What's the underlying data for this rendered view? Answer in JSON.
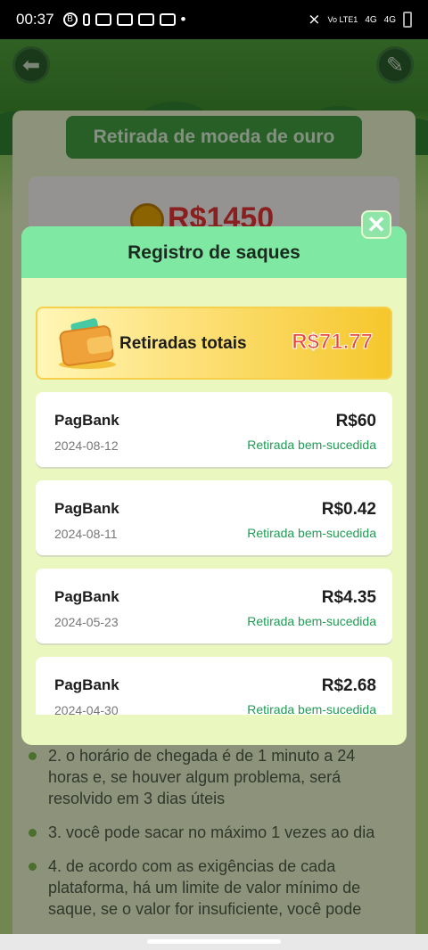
{
  "status_bar": {
    "time": "00:37",
    "b_badge": "B",
    "net_label": "Vo LTE1",
    "sig1": "4G",
    "sig2": "4G"
  },
  "background": {
    "title": "Retirada de moeda de ouro",
    "balance": "R$1450",
    "rules": [
      "2. o horário de chegada é de 1 minuto a 24 horas e, se houver algum problema, será resolvido em 3 dias úteis",
      "3. você pode sacar no máximo 1 vezes ao dia",
      "4. de acordo com as exigências de cada plataforma, há um limite de valor mínimo de saque, se o valor for insuficiente, você pode"
    ]
  },
  "modal": {
    "title": "Registro de saques",
    "close_icon": "close-icon",
    "total_label": "Retiradas totais",
    "total_amount": "R$71.77",
    "records": [
      {
        "name": "PagBank",
        "date": "2024-08-12",
        "amount": "R$60",
        "status": "Retirada bem-sucedida"
      },
      {
        "name": "PagBank",
        "date": "2024-08-11",
        "amount": "R$0.42",
        "status": "Retirada bem-sucedida"
      },
      {
        "name": "PagBank",
        "date": "2024-05-23",
        "amount": "R$4.35",
        "status": "Retirada bem-sucedida"
      },
      {
        "name": "PagBank",
        "date": "2024-04-30",
        "amount": "R$2.68",
        "status": "Retirada bem-sucedida"
      }
    ]
  },
  "colors": {
    "header_green": "#7fe8a2",
    "modal_bg": "#eaf8bf",
    "amount_red": "#e8453c",
    "success_green": "#1f9b54"
  }
}
